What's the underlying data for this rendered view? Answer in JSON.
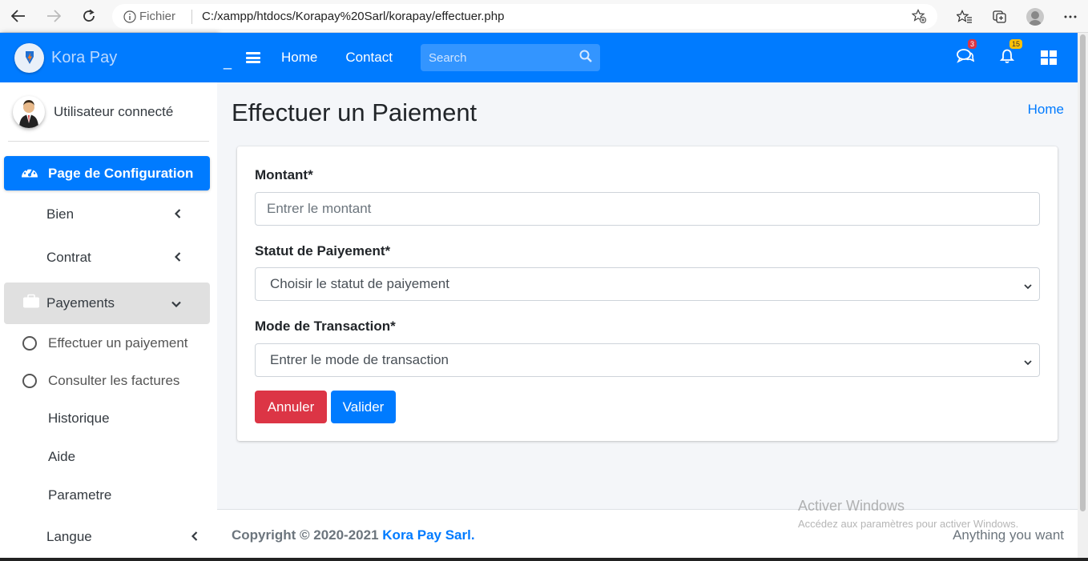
{
  "browser": {
    "info_label": "Fichier",
    "url": "C:/xampp/htdocs/Korapay%20Sarl/korapay/effectuer.php"
  },
  "brand": {
    "name": "Kora Pay"
  },
  "user": {
    "name": "Utilisateur connecté"
  },
  "sidebar": {
    "config_label": "Page de Configuration",
    "bien_label": "Bien",
    "contrat_label": "Contrat",
    "payements_label": "Payements",
    "sub_items": [
      "Effectuer un paiyement",
      "Consulter les factures"
    ],
    "historique_label": "Historique",
    "aide_label": "Aide",
    "parametre_label": "Parametre",
    "langue_label": "Langue"
  },
  "topnav": {
    "underscore": "_",
    "home": "Home",
    "contact": "Contact",
    "search_placeholder": "Search",
    "messages_count": "3",
    "notifications_count": "15"
  },
  "content": {
    "title": "Effectuer un Paiement",
    "breadcrumb": "Home"
  },
  "form": {
    "montant_label": "Montant*",
    "montant_placeholder": "Entrer le montant",
    "statut_label": "Statut de Paiyement*",
    "statut_value": "Choisir le statut de paiyement",
    "mode_label": "Mode de Transaction*",
    "mode_value": "Entrer le mode de transaction",
    "cancel_label": "Annuler",
    "submit_label": "Valider"
  },
  "footer": {
    "copyright_prefix": "Copyright © 2020-2021",
    "brand": "Kora Pay Sarl.",
    "right_text": "Anything you want"
  },
  "watermark": {
    "line1": "Activer Windows",
    "line2": "Accédez aux paramètres pour activer Windows."
  },
  "colors": {
    "primary": "#007bff",
    "danger": "#dc3545",
    "warning": "#ffc107"
  }
}
